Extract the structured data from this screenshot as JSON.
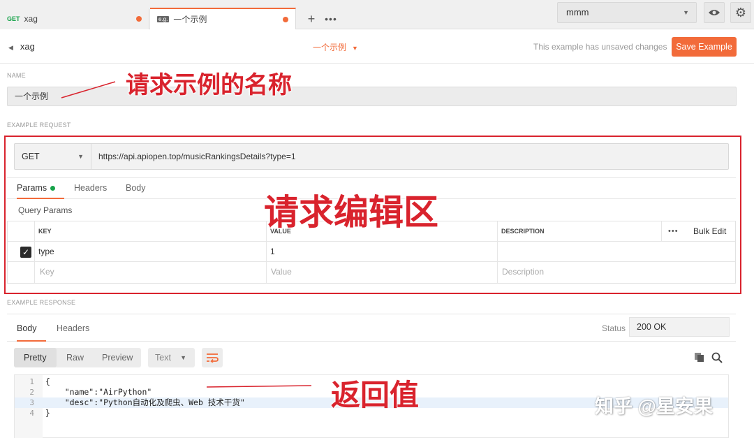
{
  "tabs": [
    {
      "method": "GET",
      "label": "xag"
    },
    {
      "icon": "example-icon",
      "icon_text": "e.g.",
      "label": "一个示例"
    }
  ],
  "env": {
    "selected": "mmm"
  },
  "header": {
    "back_label": "xag",
    "center_title": "一个示例",
    "unsaved_text": "This example has unsaved changes",
    "save_label": "Save Example"
  },
  "name_section": {
    "label": "NAME",
    "value": "一个示例"
  },
  "request_section": {
    "label": "EXAMPLE REQUEST",
    "method": "GET",
    "url": "https://api.apiopen.top/musicRankingsDetails?type=1",
    "tabs": [
      "Params",
      "Headers",
      "Body"
    ],
    "query_params_label": "Query Params",
    "table": {
      "headers": [
        "KEY",
        "VALUE",
        "DESCRIPTION"
      ],
      "bulk_edit": "Bulk Edit",
      "rows": [
        {
          "key": "type",
          "value": "1",
          "checked": true
        }
      ],
      "placeholders": {
        "key": "Key",
        "value": "Value",
        "description": "Description"
      }
    }
  },
  "response_section": {
    "label": "EXAMPLE RESPONSE",
    "tabs": [
      "Body",
      "Headers"
    ],
    "status_label": "Status",
    "status_value": "200 OK",
    "view_modes": [
      "Pretty",
      "Raw",
      "Preview"
    ],
    "format": "Text",
    "code_lines": [
      {
        "num": "1",
        "text": "{"
      },
      {
        "num": "2",
        "text": "    \"name\":\"AirPython\""
      },
      {
        "num": "3",
        "text": "    \"desc\":\"Python自动化及爬虫、Web 技术干货\""
      },
      {
        "num": "4",
        "text": "}"
      }
    ]
  },
  "annotations": {
    "name": "请求示例的名称",
    "request": "请求编辑区",
    "response": "返回值"
  },
  "watermark": "知乎 @星安果",
  "colors": {
    "accent": "#f26b3a",
    "annotation": "#d9232d",
    "method_get": "#17a34a"
  }
}
